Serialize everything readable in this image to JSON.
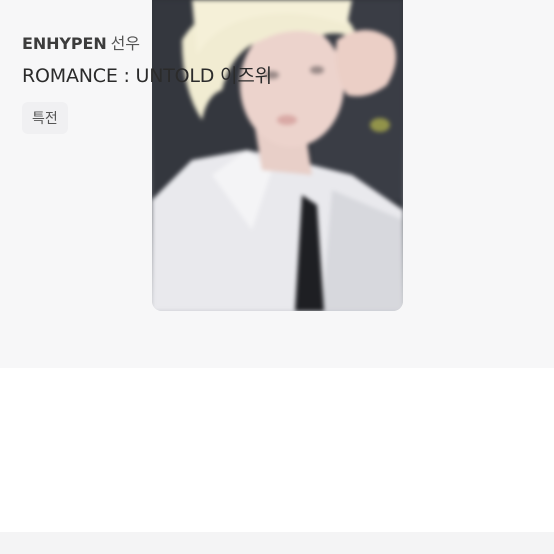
{
  "product": {
    "group": "ENHYPEN",
    "member": "선우",
    "title": "ROMANCE : UNTOLD 이즈위",
    "tag": "특전"
  },
  "colors": {
    "image_background": "#f7f7f8",
    "tag_background": "#f0f0f2",
    "text_primary": "#2b2b2b"
  }
}
